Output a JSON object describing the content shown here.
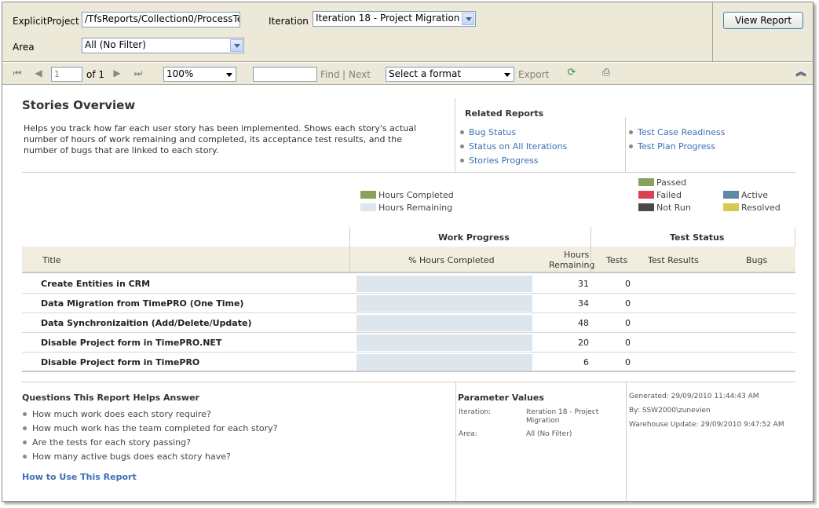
{
  "params": {
    "explicit_project_label": "ExplicitProject",
    "explicit_project_value": "/TfsReports/Collection0/ProcessTe",
    "iteration_label": "Iteration",
    "iteration_value": "Iteration 18 - Project Migration",
    "area_label": "Area",
    "area_value": "All (No Filter)",
    "view_report_label": "View Report"
  },
  "toolbar": {
    "page_value": "1",
    "of_pages": "of 1",
    "zoom": "100%",
    "find_label": "Find",
    "separator": "|",
    "next_label": "Next",
    "format_value": "Select a format",
    "export_label": "Export",
    "icons": [
      "first-page-icon",
      "previous-page-icon",
      "next-page-icon",
      "last-page-icon",
      "refresh-icon",
      "print-icon",
      "collapse-icon"
    ]
  },
  "report": {
    "title": "Stories Overview",
    "description": "Helps you track how far each user story has been implemented. Shows each story's actual number of hours of work remaining and completed, its acceptance test results, and the number of bugs that are linked to each story.",
    "related_title": "Related Reports",
    "related_links_left": [
      "Bug Status",
      "Status on All Iterations",
      "Stories Progress"
    ],
    "related_links_right": [
      "Test Case Readiness",
      "Test Plan Progress"
    ]
  },
  "legend": {
    "hours_completed": "Hours Completed",
    "hours_remaining": "Hours Remaining",
    "passed": "Passed",
    "failed": "Failed",
    "not_run": "Not Run",
    "active": "Active",
    "resolved": "Resolved",
    "colors": {
      "hours_completed": "#8aa15a",
      "hours_remaining": "#dde5ed",
      "passed": "#8aa15a",
      "failed": "#d9424e",
      "not_run": "#4a4a4a",
      "active": "#5f88a8",
      "resolved": "#d9c850"
    }
  },
  "table": {
    "group_work_progress": "Work Progress",
    "group_test_status": "Test Status",
    "col_title": "Title",
    "col_pct_completed": "% Hours Completed",
    "col_hours_remaining_1": "Hours",
    "col_hours_remaining_2": "Remaining",
    "col_tests": "Tests",
    "col_test_results": "Test Results",
    "col_bugs": "Bugs",
    "rows": [
      {
        "title": "Create Entities in CRM",
        "hours_remaining": "31",
        "tests": "0"
      },
      {
        "title": "Data Migration from TimePRO (One Time)",
        "hours_remaining": "34",
        "tests": "0"
      },
      {
        "title": "Data Synchronizaition (Add/Delete/Update)",
        "hours_remaining": "48",
        "tests": "0"
      },
      {
        "title": "Disable Project form in TimePRO.NET",
        "hours_remaining": "20",
        "tests": "0"
      },
      {
        "title": "Disable Project form in TimePRO",
        "hours_remaining": "6",
        "tests": "0"
      }
    ]
  },
  "footer": {
    "questions_title": "Questions This Report Helps Answer",
    "questions": [
      "How much work does each story require?",
      "How much work has the team completed for each story?",
      "Are the tests for each story passing?",
      "How many active bugs does each story have?"
    ],
    "how_to": "How to Use This Report",
    "param_values_title": "Parameter Values",
    "iteration_key": "Iteration:",
    "iteration_val_1": "Iteration 18 - Project",
    "iteration_val_2": "Migration",
    "area_key": "Area:",
    "area_val": "All (No Filter)",
    "generated": "Generated: 29/09/2010 11:44:43 AM",
    "by": "By: SSW2000\\zunevien",
    "warehouse": "Warehouse Update: 29/09/2010 9:47:52 AM"
  }
}
